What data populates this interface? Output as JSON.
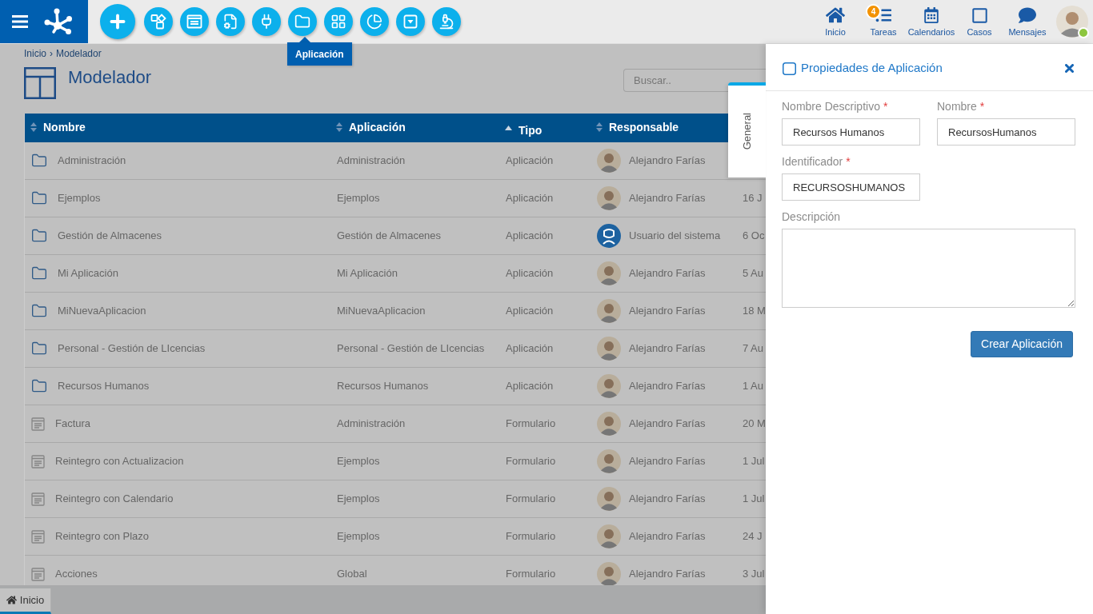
{
  "topbar": {
    "tooltip": "Aplicación",
    "nav": [
      {
        "label": "Inicio"
      },
      {
        "label": "Tareas",
        "badge": "4"
      },
      {
        "label": "Calendarios"
      },
      {
        "label": "Casos"
      },
      {
        "label": "Mensajes"
      }
    ],
    "user": {
      "online": true
    }
  },
  "breadcrumb": {
    "items": [
      "Inicio",
      "Modelador"
    ],
    "separator": "›"
  },
  "page": {
    "title": "Modelador",
    "search": {
      "placeholder": "Buscar.."
    }
  },
  "table": {
    "columns": [
      {
        "label": "Nombre",
        "sorted": false
      },
      {
        "label": "Aplicación",
        "sorted": false
      },
      {
        "label": "Tipo",
        "sorted": true
      },
      {
        "label": "Responsable",
        "sorted": false
      }
    ],
    "rows": [
      {
        "kind": "application",
        "name": "Administración",
        "application": "Administración",
        "type": "Aplicación",
        "owner": {
          "kind": "person",
          "name": "Alejandro Farías"
        }
      },
      {
        "kind": "application",
        "name": "Ejemplos",
        "application": "Ejemplos",
        "type": "Aplicación",
        "owner": {
          "kind": "person",
          "name": "Alejandro Farías"
        },
        "date": "16 J"
      },
      {
        "kind": "application",
        "name": "Gestión de Almacenes",
        "application": "Gestión de Almacenes",
        "type": "Aplicación",
        "owner": {
          "kind": "system",
          "name": "Usuario del sistema"
        },
        "date": "6 Oc"
      },
      {
        "kind": "application",
        "name": "Mi Aplicación",
        "application": "Mi Aplicación",
        "type": "Aplicación",
        "owner": {
          "kind": "person",
          "name": "Alejandro Farías"
        },
        "date": "5 Au"
      },
      {
        "kind": "application",
        "name": "MiNuevaAplicacion",
        "application": "MiNuevaAplicacion",
        "type": "Aplicación",
        "owner": {
          "kind": "person",
          "name": "Alejandro Farías"
        },
        "date": "18 M"
      },
      {
        "kind": "application",
        "name": "Personal - Gestión de LIcencias",
        "application": "Personal - Gestión de LIcencias",
        "type": "Aplicación",
        "owner": {
          "kind": "person",
          "name": "Alejandro Farías"
        },
        "date": "7 Au"
      },
      {
        "kind": "application",
        "name": "Recursos Humanos",
        "application": "Recursos Humanos",
        "type": "Aplicación",
        "owner": {
          "kind": "person",
          "name": "Alejandro Farías"
        },
        "date": "1 Au"
      },
      {
        "kind": "form",
        "name": "Factura",
        "application": "Administración",
        "type": "Formulario",
        "owner": {
          "kind": "person",
          "name": "Alejandro Farías"
        },
        "date": "20 M"
      },
      {
        "kind": "form",
        "name": "Reintegro con Actualizacion",
        "application": "Ejemplos",
        "type": "Formulario",
        "owner": {
          "kind": "person",
          "name": "Alejandro Farías"
        },
        "date": "1 Jul"
      },
      {
        "kind": "form",
        "name": "Reintegro con Calendario",
        "application": "Ejemplos",
        "type": "Formulario",
        "owner": {
          "kind": "person",
          "name": "Alejandro Farías"
        },
        "date": "1 Jul"
      },
      {
        "kind": "form",
        "name": "Reintegro con Plazo",
        "application": "Ejemplos",
        "type": "Formulario",
        "owner": {
          "kind": "person",
          "name": "Alejandro Farías"
        },
        "date": "24 J"
      },
      {
        "kind": "form",
        "name": "Acciones",
        "application": "Global",
        "type": "Formulario",
        "owner": {
          "kind": "person",
          "name": "Alejandro Farías"
        },
        "date": "3 Jul"
      }
    ]
  },
  "bottom_tabs": [
    {
      "label": "Inicio",
      "selected": true
    }
  ],
  "panel": {
    "title": "Propiedades de Aplicación",
    "side_tabs": [
      {
        "label": "General",
        "selected": true
      }
    ],
    "fields": [
      {
        "kind": "input",
        "label": "Nombre Descriptivo",
        "required_mark": "*",
        "value": "Recursos Humanos"
      },
      {
        "kind": "input",
        "label": "Nombre",
        "required_mark": "*",
        "value": "RecursosHumanos"
      },
      {
        "kind": "input",
        "label": "Identificador",
        "required_mark": "*",
        "value": "RECURSOSHUMANOS"
      },
      {
        "kind": "textarea",
        "label": "Descripción"
      }
    ],
    "submit": "Crear Aplicación"
  }
}
